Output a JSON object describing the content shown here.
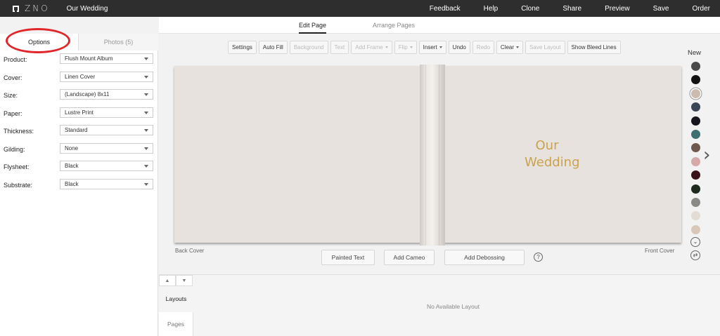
{
  "app": {
    "logo_text": "ZNO",
    "project_title": "Our Wedding"
  },
  "topnav": [
    "Feedback",
    "Help",
    "Clone",
    "Share",
    "Preview",
    "Save",
    "Order"
  ],
  "mode_tabs": {
    "edit_page": "Edit Page",
    "arrange_pages": "Arrange Pages",
    "active": "Edit Page"
  },
  "sidebar": {
    "tabs": {
      "options": "Options",
      "photos": "Photos (5)",
      "active": "Options"
    },
    "options": [
      {
        "label": "Product:",
        "value": "Flush Mount Album"
      },
      {
        "label": "Cover:",
        "value": "Linen Cover"
      },
      {
        "label": "Size:",
        "value": "(Landscape) 8x11"
      },
      {
        "label": "Paper:",
        "value": "Lustre Print"
      },
      {
        "label": "Thickness:",
        "value": "Standard"
      },
      {
        "label": "Gilding:",
        "value": "None"
      },
      {
        "label": "Flysheet:",
        "value": "Black"
      },
      {
        "label": "Substrate:",
        "value": "Black"
      }
    ],
    "annotation_color": "#e1262b"
  },
  "toolbar": {
    "settings": "Settings",
    "auto_fill": "Auto Fill",
    "background": "Background",
    "text": "Text",
    "add_frame": "Add Frame",
    "flip": "Flip",
    "insert": "Insert",
    "undo": "Undo",
    "redo": "Redo",
    "clear": "Clear",
    "save_layout": "Save Layout",
    "show_bleed_lines": "Show Bleed Lines"
  },
  "canvas": {
    "cover_text_line1": "Our",
    "cover_text_line2": "Wedding",
    "back_cover_label": "Back Cover",
    "front_cover_label": "Front Cover",
    "cover_color": "#e8e2de",
    "foil_color": "#c9a24d"
  },
  "actions": {
    "painted_text": "Painted Text",
    "add_cameo": "Add Cameo",
    "add_debossing": "Add Debossing",
    "help": "?"
  },
  "swatches": {
    "title": "New",
    "colors": [
      "#4a4a4a",
      "#111111",
      "#cbbcae",
      "#3b4558",
      "#16161c",
      "#3f6f6e",
      "#6e5a4c",
      "#d4a9a8",
      "#3a1219",
      "#1c2a1f",
      "#8c8a87",
      "#e2dcd2",
      "#d9c8b8"
    ],
    "selected_index": 2
  },
  "bottom_panel": {
    "up": "▲",
    "down": "▼",
    "layouts_tab": "Layouts",
    "pages_tab": "Pages",
    "empty_message": "No Available Layout"
  }
}
